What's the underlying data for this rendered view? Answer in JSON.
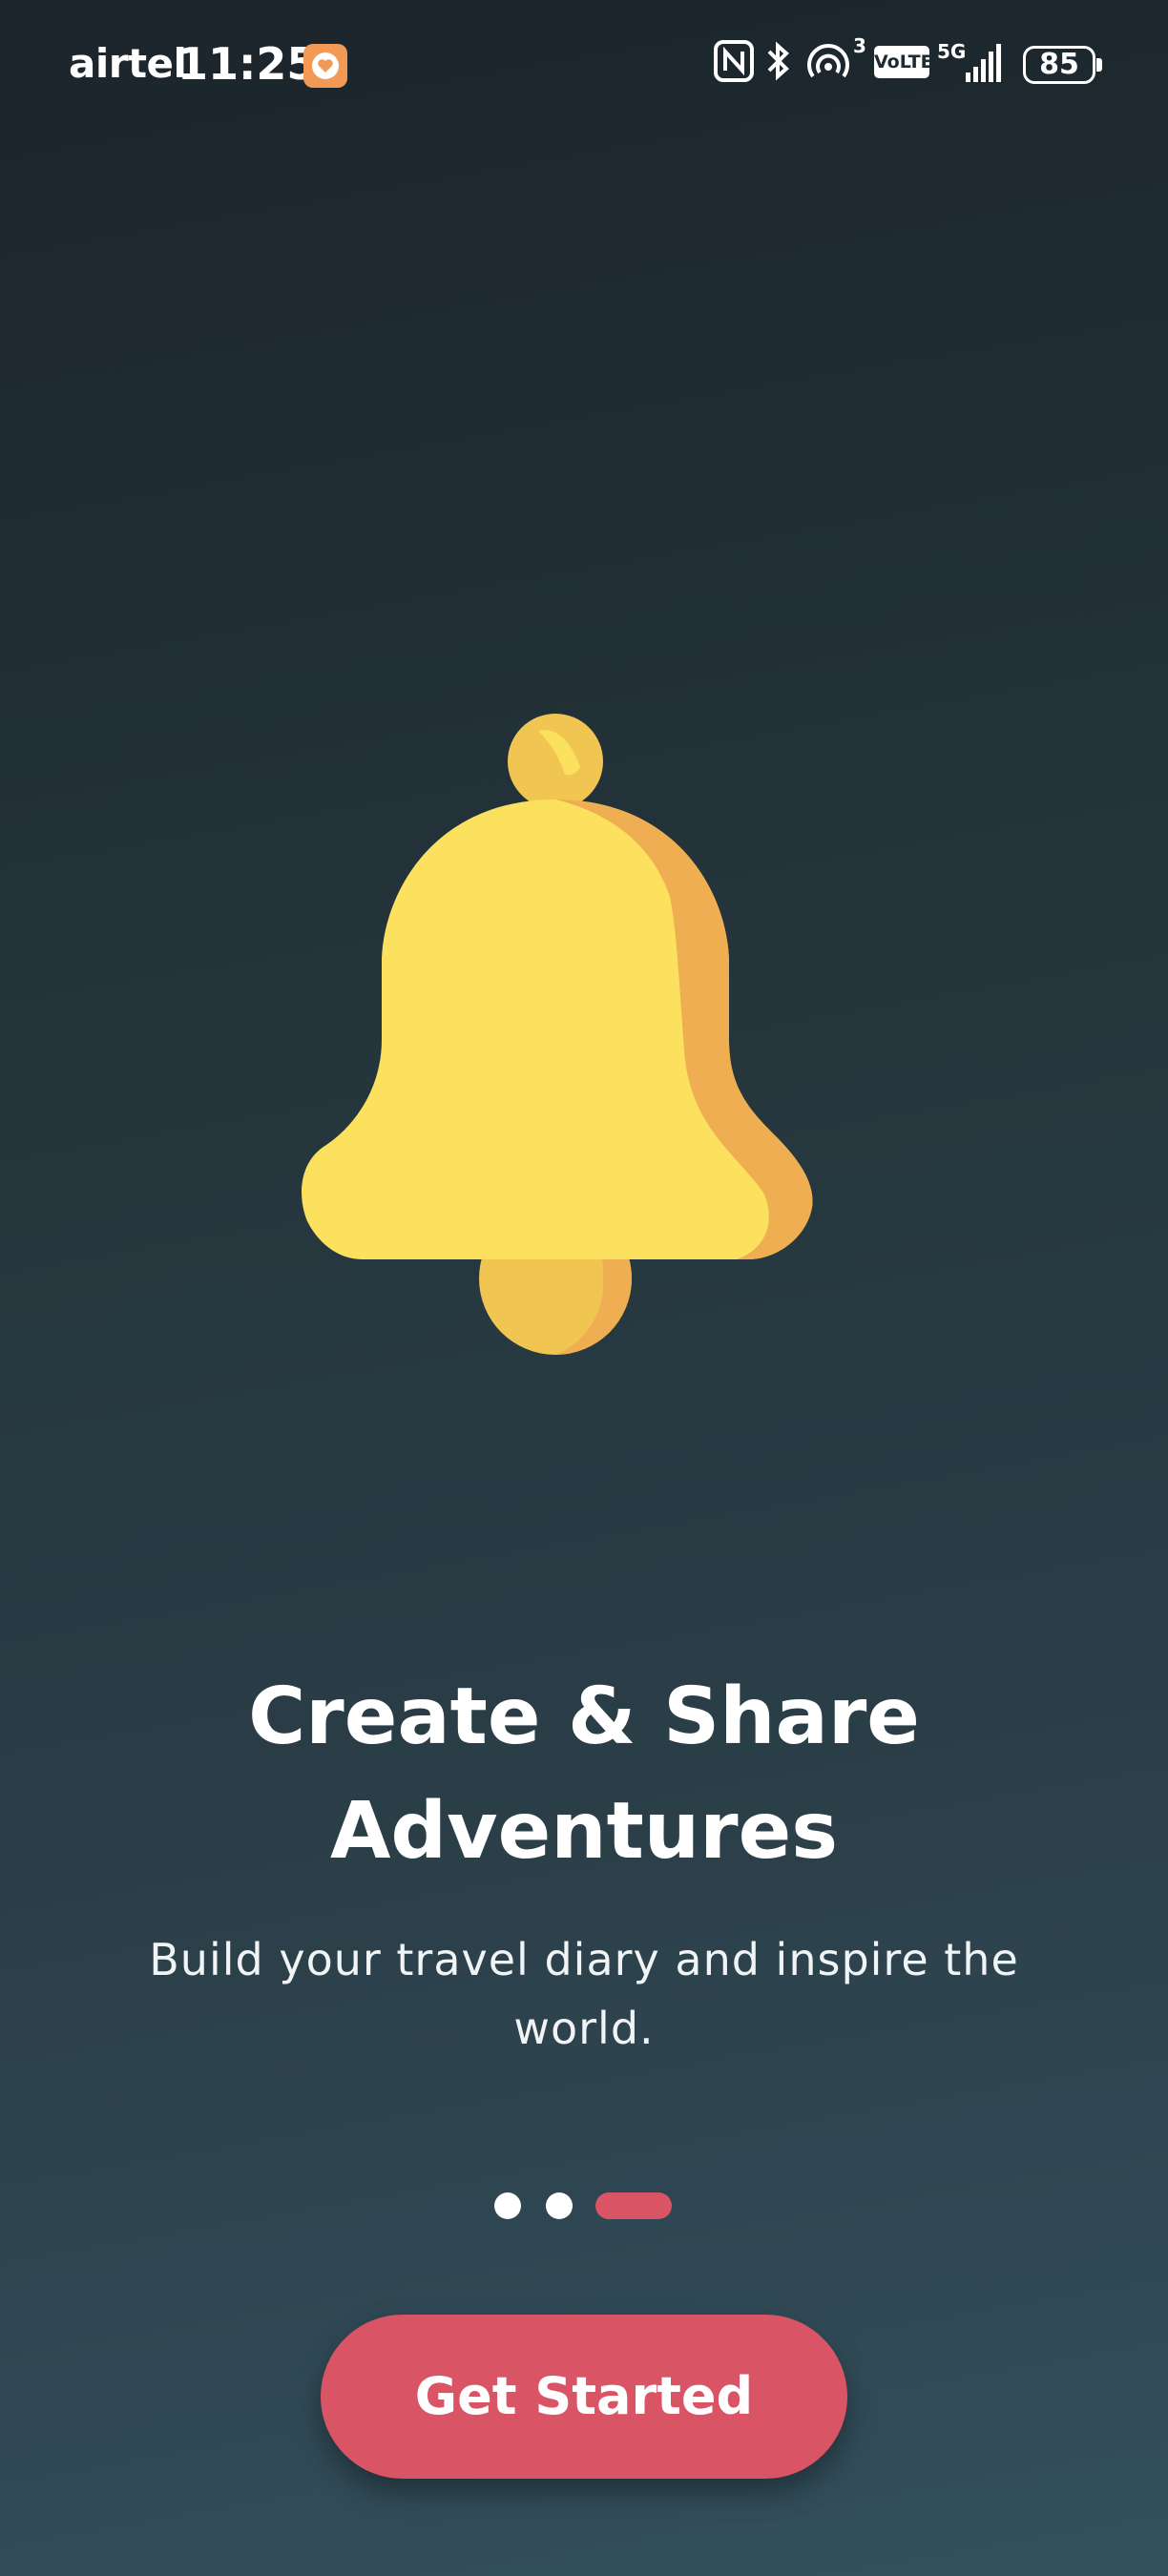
{
  "status_bar": {
    "carrier": "airtel",
    "time": "11:25",
    "icons": [
      "nfc-icon",
      "bluetooth-icon",
      "hotspot-icon",
      "volte-icon",
      "signal-5g-icon",
      "battery-icon"
    ],
    "hotspot_count": "3",
    "volte_label": "VoLTE",
    "network_label": "5G",
    "battery_level": "85"
  },
  "onboarding": {
    "illustration": "bell-icon",
    "title_line1": "Create & Share",
    "title_line2": "Adventures",
    "subtitle_line1": "Build your travel diary and inspire the",
    "subtitle_line2": "world.",
    "pager": {
      "total": 3,
      "active_index": 2
    },
    "cta_label": "Get Started"
  },
  "colors": {
    "accent": "#d95566",
    "bell_yellow": "#fbe15e",
    "bell_shade": "#f0ae52",
    "background_top": "#1b252b",
    "background_bottom": "#33505c"
  }
}
